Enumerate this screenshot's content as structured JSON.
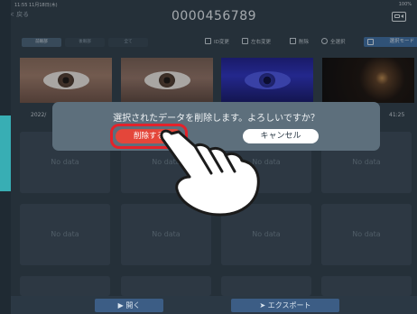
{
  "status_bar": {
    "time": "11:55 11月18日(木)",
    "battery": "100%"
  },
  "header": {
    "back_label": "< 戻る",
    "title": "0000456789"
  },
  "tabs": [
    "前眼部",
    "後眼部",
    "全て"
  ],
  "toolbar": {
    "id_change": "ID変更",
    "lr_change": "左右変更",
    "delete": "削除",
    "select_all": "全選択",
    "select_mode": "選択モード"
  },
  "thumbnails": {
    "date_left": "2022/",
    "time_right": "41:25"
  },
  "grid": {
    "empty_label": "No data"
  },
  "dialog": {
    "message": "選択されたデータを削除します。よろしいですか？",
    "confirm_label": "削除する",
    "cancel_label": "キャンセル"
  },
  "bottom_bar": {
    "open_label": "開く",
    "export_label": "エクスポート"
  },
  "colors": {
    "accent": "#3f6ea1",
    "delete": "#e4463a",
    "highlight": "#e3222a"
  }
}
